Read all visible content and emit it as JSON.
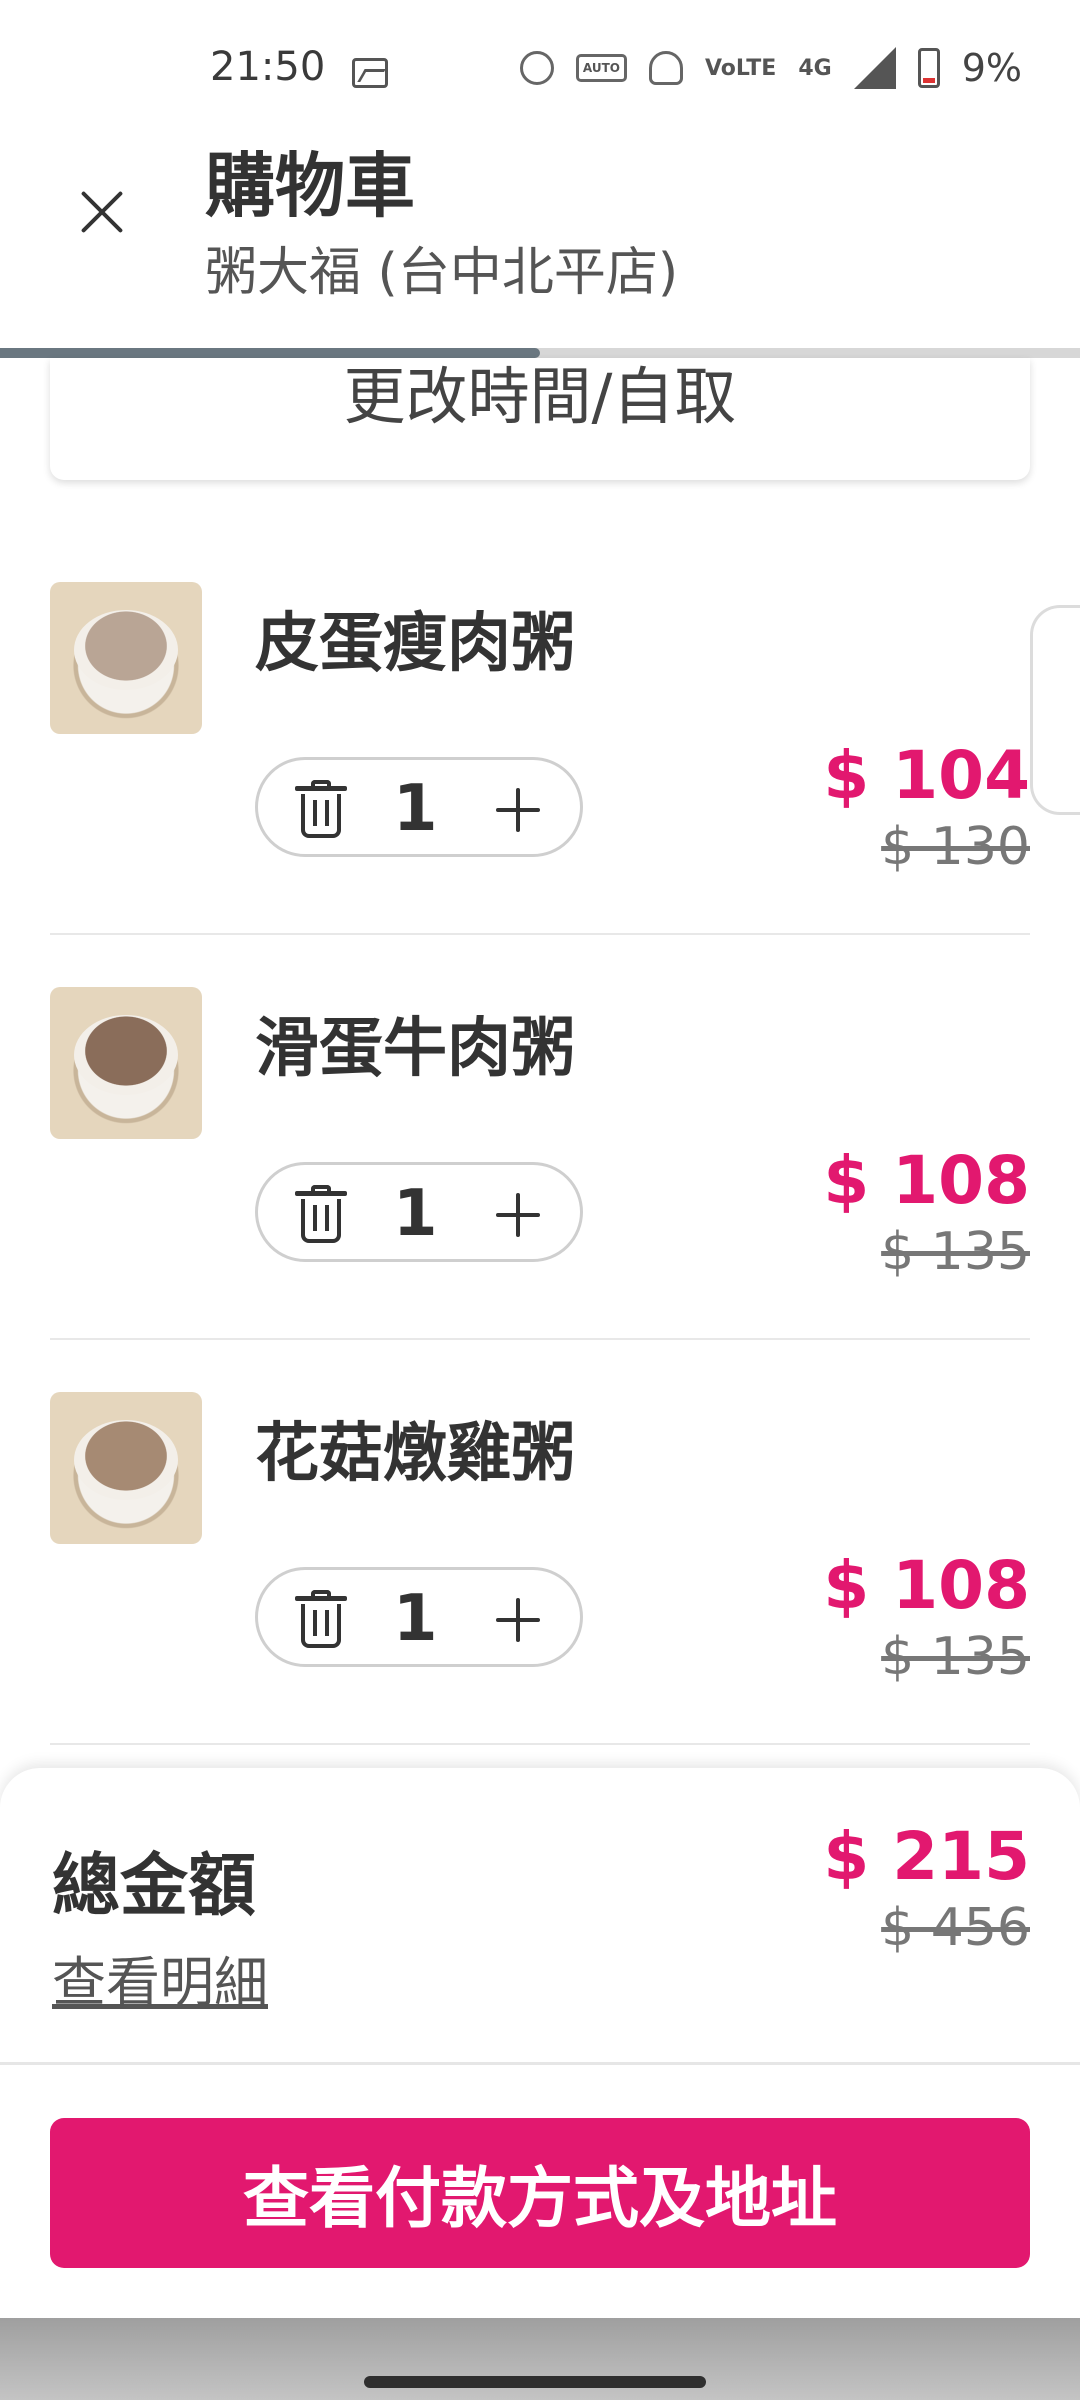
{
  "status_bar": {
    "time": "21:50",
    "icons": [
      "image-icon",
      "alarm-icon",
      "auto-hz-icon",
      "bell-off-icon",
      "volte-icon",
      "4g-icon",
      "signal-icon",
      "battery-icon"
    ],
    "auto_label": "AUTO",
    "volte_label": "VoLTE",
    "network_label": "4G",
    "battery_percent": "9%"
  },
  "header": {
    "title": "購物車",
    "subtitle": "粥大福 (台中北平店)",
    "progress": 0.5
  },
  "schedule": {
    "label": "更改時間/自取"
  },
  "items": [
    {
      "name": "皮蛋瘦肉粥",
      "quantity": "1",
      "price": "$ 104",
      "original_price": "$ 130"
    },
    {
      "name": "滑蛋牛肉粥",
      "quantity": "1",
      "price": "$ 108",
      "original_price": "$ 135"
    },
    {
      "name": "花菇燉雞粥",
      "quantity": "1",
      "price": "$ 108",
      "original_price": "$ 135"
    }
  ],
  "summary": {
    "total_label": "總金額",
    "detail_link": "查看明細",
    "total_price": "$ 215",
    "total_original": "$ 456"
  },
  "checkout": {
    "label": "查看付款方式及地址"
  },
  "colors": {
    "accent": "#e2186f",
    "text": "#333333",
    "muted": "#777777"
  }
}
